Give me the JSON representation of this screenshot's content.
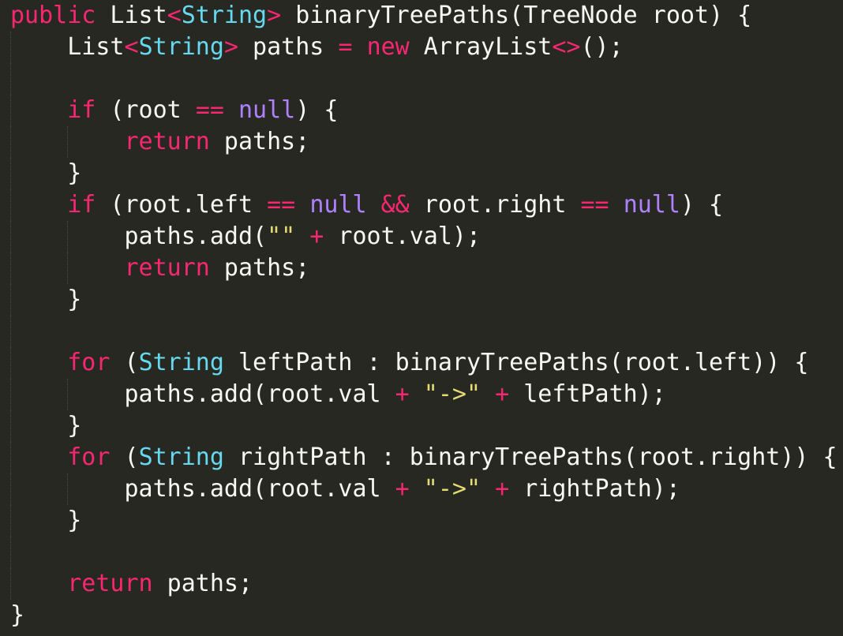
{
  "colors": {
    "background": "#272822",
    "plain": "#f8f8f2",
    "keyword": "#f92672",
    "type": "#66d9ef",
    "constant": "#ae81ff",
    "string": "#e6db74"
  },
  "lines": [
    {
      "guides": [],
      "tokens": [
        {
          "c": "kw",
          "t": "public"
        },
        {
          "c": "plain",
          "t": " List"
        },
        {
          "c": "kw",
          "t": "<"
        },
        {
          "c": "type",
          "t": "String"
        },
        {
          "c": "kw",
          "t": ">"
        },
        {
          "c": "plain",
          "t": " binaryTreePaths(TreeNode root) {"
        }
      ]
    },
    {
      "guides": [
        1
      ],
      "tokens": [
        {
          "c": "plain",
          "t": "    List"
        },
        {
          "c": "kw",
          "t": "<"
        },
        {
          "c": "type",
          "t": "String"
        },
        {
          "c": "kw",
          "t": ">"
        },
        {
          "c": "plain",
          "t": " paths "
        },
        {
          "c": "kw",
          "t": "="
        },
        {
          "c": "plain",
          "t": " "
        },
        {
          "c": "kw",
          "t": "new"
        },
        {
          "c": "plain",
          "t": " ArrayList"
        },
        {
          "c": "kw",
          "t": "<>"
        },
        {
          "c": "plain",
          "t": "();"
        }
      ]
    },
    {
      "guides": [
        1
      ],
      "tokens": []
    },
    {
      "guides": [
        1
      ],
      "tokens": [
        {
          "c": "plain",
          "t": "    "
        },
        {
          "c": "kw",
          "t": "if"
        },
        {
          "c": "plain",
          "t": " (root "
        },
        {
          "c": "kw",
          "t": "=="
        },
        {
          "c": "plain",
          "t": " "
        },
        {
          "c": "const",
          "t": "null"
        },
        {
          "c": "plain",
          "t": ") {"
        }
      ]
    },
    {
      "guides": [
        1,
        2
      ],
      "tokens": [
        {
          "c": "plain",
          "t": "        "
        },
        {
          "c": "kw",
          "t": "return"
        },
        {
          "c": "plain",
          "t": " paths;"
        }
      ]
    },
    {
      "guides": [
        1
      ],
      "tokens": [
        {
          "c": "plain",
          "t": "    }"
        }
      ]
    },
    {
      "guides": [
        1
      ],
      "tokens": [
        {
          "c": "plain",
          "t": "    "
        },
        {
          "c": "kw",
          "t": "if"
        },
        {
          "c": "plain",
          "t": " (root.left "
        },
        {
          "c": "kw",
          "t": "=="
        },
        {
          "c": "plain",
          "t": " "
        },
        {
          "c": "const",
          "t": "null"
        },
        {
          "c": "plain",
          "t": " "
        },
        {
          "c": "kw",
          "t": "&&"
        },
        {
          "c": "plain",
          "t": " root.right "
        },
        {
          "c": "kw",
          "t": "=="
        },
        {
          "c": "plain",
          "t": " "
        },
        {
          "c": "const",
          "t": "null"
        },
        {
          "c": "plain",
          "t": ") {"
        }
      ]
    },
    {
      "guides": [
        1,
        2
      ],
      "tokens": [
        {
          "c": "plain",
          "t": "        paths.add("
        },
        {
          "c": "str",
          "t": "\"\""
        },
        {
          "c": "plain",
          "t": " "
        },
        {
          "c": "kw",
          "t": "+"
        },
        {
          "c": "plain",
          "t": " root.val);"
        }
      ]
    },
    {
      "guides": [
        1,
        2
      ],
      "tokens": [
        {
          "c": "plain",
          "t": "        "
        },
        {
          "c": "kw",
          "t": "return"
        },
        {
          "c": "plain",
          "t": " paths;"
        }
      ]
    },
    {
      "guides": [
        1
      ],
      "tokens": [
        {
          "c": "plain",
          "t": "    }"
        }
      ]
    },
    {
      "guides": [
        1
      ],
      "tokens": []
    },
    {
      "guides": [
        1
      ],
      "tokens": [
        {
          "c": "plain",
          "t": "    "
        },
        {
          "c": "kw",
          "t": "for"
        },
        {
          "c": "plain",
          "t": " ("
        },
        {
          "c": "type",
          "t": "String"
        },
        {
          "c": "plain",
          "t": " leftPath : binaryTreePaths(root.left)) {"
        }
      ]
    },
    {
      "guides": [
        1,
        2
      ],
      "tokens": [
        {
          "c": "plain",
          "t": "        paths.add(root.val "
        },
        {
          "c": "kw",
          "t": "+"
        },
        {
          "c": "plain",
          "t": " "
        },
        {
          "c": "str",
          "t": "\"->\""
        },
        {
          "c": "plain",
          "t": " "
        },
        {
          "c": "kw",
          "t": "+"
        },
        {
          "c": "plain",
          "t": " leftPath);"
        }
      ]
    },
    {
      "guides": [
        1
      ],
      "tokens": [
        {
          "c": "plain",
          "t": "    }"
        }
      ]
    },
    {
      "guides": [
        1
      ],
      "tokens": [
        {
          "c": "plain",
          "t": "    "
        },
        {
          "c": "kw",
          "t": "for"
        },
        {
          "c": "plain",
          "t": " ("
        },
        {
          "c": "type",
          "t": "String"
        },
        {
          "c": "plain",
          "t": " rightPath : binaryTreePaths(root.right)) {"
        }
      ]
    },
    {
      "guides": [
        1,
        2
      ],
      "tokens": [
        {
          "c": "plain",
          "t": "        paths.add(root.val "
        },
        {
          "c": "kw",
          "t": "+"
        },
        {
          "c": "plain",
          "t": " "
        },
        {
          "c": "str",
          "t": "\"->\""
        },
        {
          "c": "plain",
          "t": " "
        },
        {
          "c": "kw",
          "t": "+"
        },
        {
          "c": "plain",
          "t": " rightPath);"
        }
      ]
    },
    {
      "guides": [
        1
      ],
      "tokens": [
        {
          "c": "plain",
          "t": "    }"
        }
      ]
    },
    {
      "guides": [
        1
      ],
      "tokens": []
    },
    {
      "guides": [
        1
      ],
      "tokens": [
        {
          "c": "plain",
          "t": "    "
        },
        {
          "c": "kw",
          "t": "return"
        },
        {
          "c": "plain",
          "t": " paths;"
        }
      ]
    },
    {
      "guides": [],
      "tokens": [
        {
          "c": "plain",
          "t": "}"
        }
      ]
    }
  ]
}
